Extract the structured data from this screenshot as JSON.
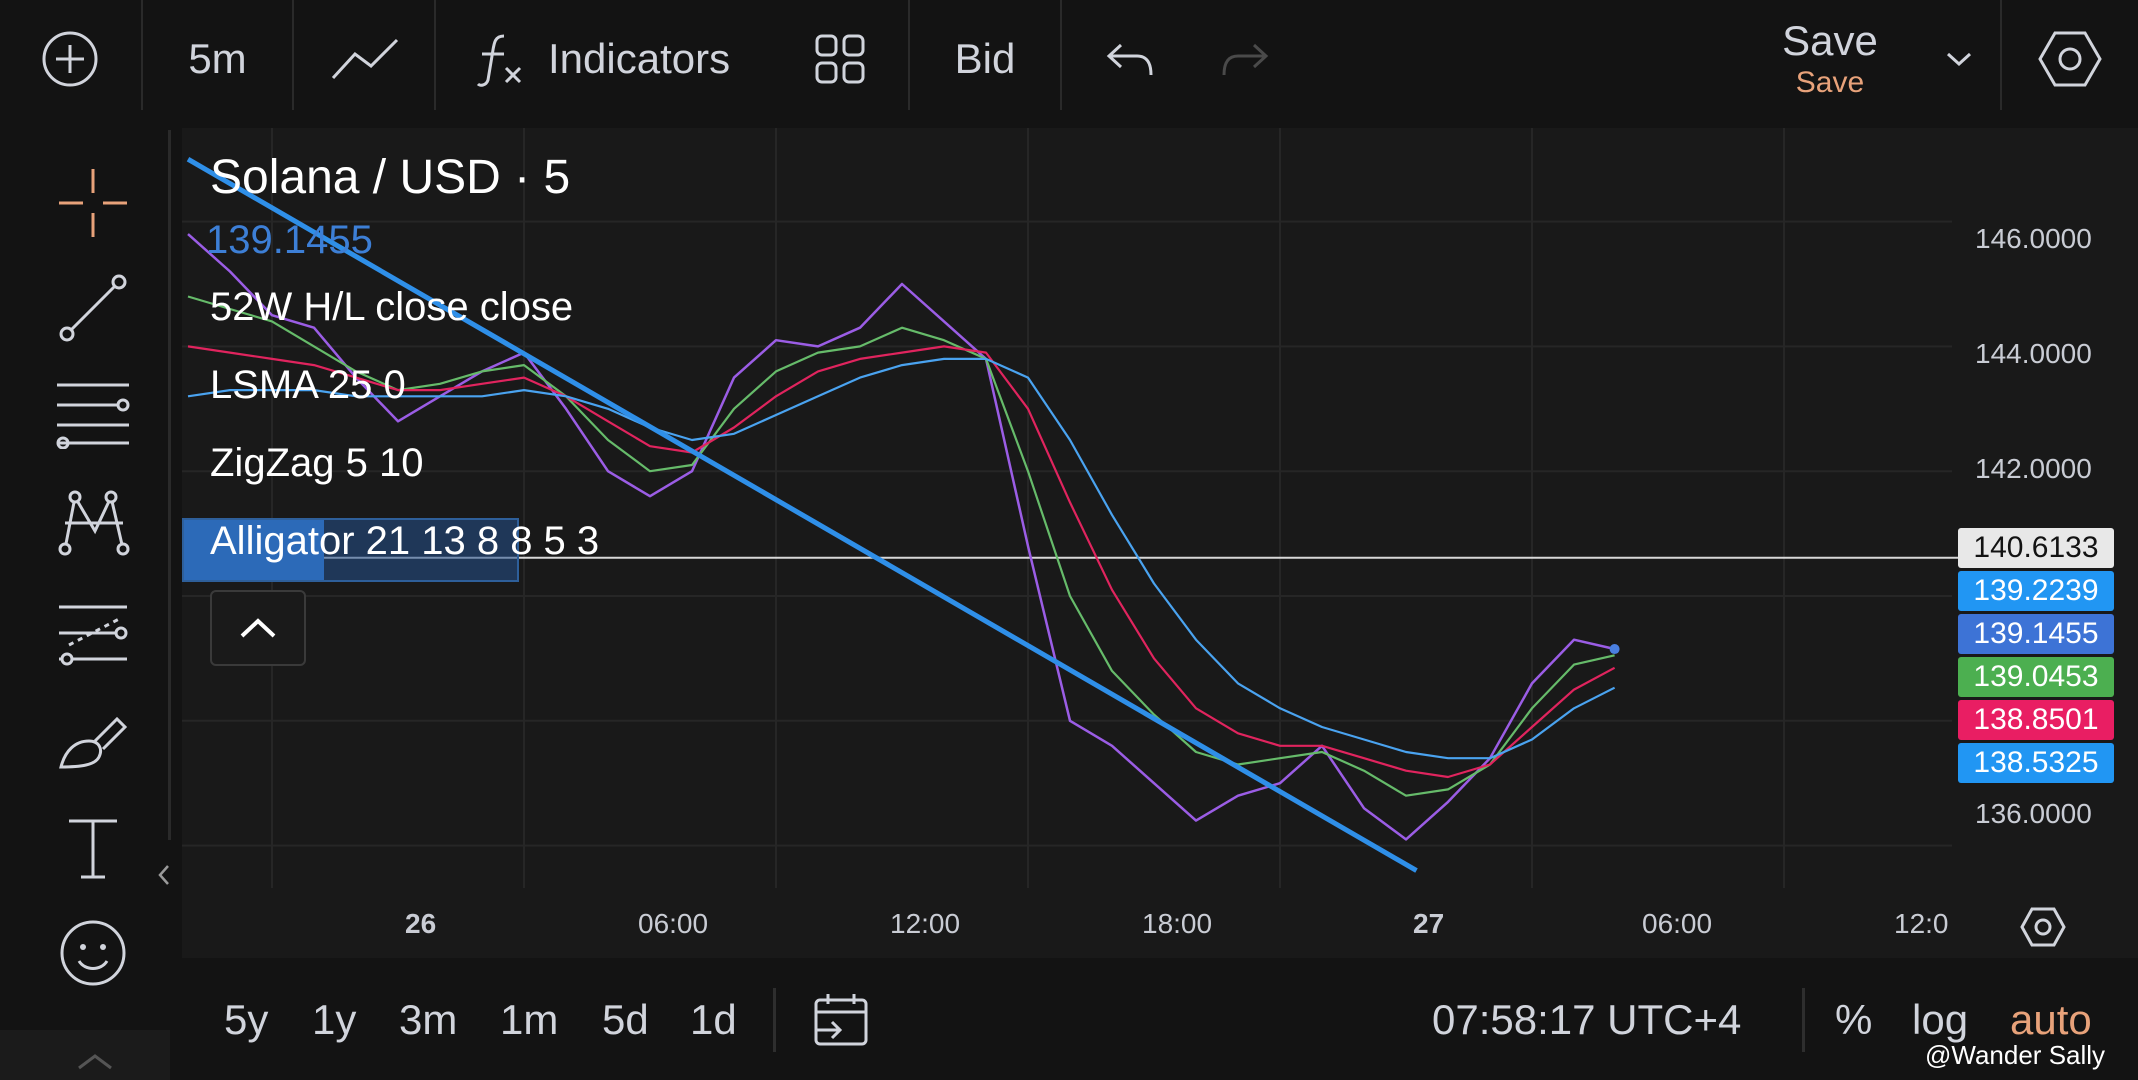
{
  "toolbar": {
    "interval": "5m",
    "indicators_label": "Indicators",
    "price_type": "Bid",
    "save_label": "Save",
    "save_sublabel": "Save"
  },
  "legend": {
    "title": "Solana / USD · 5",
    "last_price": "139.1455",
    "rows": [
      "52W H/L close close",
      "LSMA 25 0",
      "ZigZag 5 10",
      "Alligator 21 13 8 8 5 3"
    ]
  },
  "price_axis": {
    "ticks": [
      "146.0000",
      "144.0000",
      "142.0000",
      "136.0000"
    ],
    "tags": [
      {
        "value": "140.6133",
        "color": "#e8e8e8",
        "text_color": "#131313"
      },
      {
        "value": "139.2239",
        "color": "#2196f3",
        "text_color": "#ffffff"
      },
      {
        "value": "139.1455",
        "color": "#3d73d6",
        "text_color": "#ffffff"
      },
      {
        "value": "139.0453",
        "color": "#4caf50",
        "text_color": "#ffffff"
      },
      {
        "value": "138.8501",
        "color": "#e91e63",
        "text_color": "#ffffff"
      },
      {
        "value": "138.5325",
        "color": "#2196f3",
        "text_color": "#ffffff"
      }
    ]
  },
  "time_axis": {
    "ticks": [
      {
        "label": "26",
        "bold": true
      },
      {
        "label": "06:00",
        "bold": false
      },
      {
        "label": "12:00",
        "bold": false
      },
      {
        "label": "18:00",
        "bold": false
      },
      {
        "label": "27",
        "bold": true
      },
      {
        "label": "06:00",
        "bold": false
      },
      {
        "label": "12:0",
        "bold": false
      }
    ]
  },
  "bottom": {
    "ranges": [
      "5y",
      "1y",
      "3m",
      "1m",
      "5d",
      "1d"
    ],
    "clock": "07:58:17 UTC+4",
    "percent": "%",
    "log": "log",
    "auto": "auto"
  },
  "watermark": "@Wander Sally",
  "chart_data": {
    "type": "line",
    "x": [
      "25 22:00",
      "25 23:00",
      "26 00:00",
      "26 01:00",
      "26 02:00",
      "26 03:00",
      "26 04:00",
      "26 05:00",
      "26 06:00",
      "26 07:00",
      "26 08:00",
      "26 09:00",
      "26 10:00",
      "26 11:00",
      "26 12:00",
      "26 13:00",
      "26 14:00",
      "26 15:00",
      "26 16:00",
      "26 17:00",
      "26 18:00",
      "26 19:00",
      "26 20:00",
      "26 21:00",
      "26 22:00",
      "26 23:00",
      "27 00:00",
      "27 01:00",
      "27 02:00",
      "27 03:00",
      "27 04:00",
      "27 05:00",
      "27 06:00",
      "27 07:00",
      "27 07:58"
    ],
    "series": [
      {
        "values": [
          145.8,
          145.2,
          144.5,
          144.3,
          143.5,
          142.8,
          143.2,
          143.6,
          143.9,
          143.0,
          142.0,
          141.6,
          142.0,
          143.5,
          144.1,
          144.0,
          144.3,
          145.0,
          144.4,
          143.8,
          140.8,
          138.0,
          137.6,
          137.0,
          136.4,
          136.8,
          137.0,
          137.6,
          136.6,
          136.1,
          136.7,
          137.4,
          138.6,
          139.3,
          139.15
        ]
      },
      {
        "values": [
          144.8,
          144.6,
          144.4,
          144.0,
          143.6,
          143.3,
          143.4,
          143.6,
          143.7,
          143.2,
          142.5,
          142.0,
          142.1,
          143.0,
          143.6,
          143.9,
          144.0,
          144.3,
          144.1,
          143.8,
          142.0,
          140.0,
          138.8,
          138.1,
          137.5,
          137.3,
          137.4,
          137.5,
          137.2,
          136.8,
          136.9,
          137.3,
          138.2,
          138.9,
          139.05
        ]
      },
      {
        "values": [
          144.0,
          143.9,
          143.8,
          143.7,
          143.5,
          143.3,
          143.3,
          143.4,
          143.5,
          143.2,
          142.8,
          142.4,
          142.3,
          142.7,
          143.2,
          143.6,
          143.8,
          143.9,
          144.0,
          143.9,
          143.0,
          141.5,
          140.1,
          139.0,
          138.2,
          137.8,
          137.6,
          137.6,
          137.4,
          137.2,
          137.1,
          137.3,
          137.9,
          138.5,
          138.85
        ]
      },
      {
        "values": [
          143.2,
          143.3,
          143.3,
          143.3,
          143.2,
          143.2,
          143.2,
          143.2,
          143.3,
          143.2,
          143.0,
          142.7,
          142.5,
          142.6,
          142.9,
          143.2,
          143.5,
          143.7,
          143.8,
          143.8,
          143.5,
          142.5,
          141.3,
          140.2,
          139.3,
          138.6,
          138.2,
          137.9,
          137.7,
          137.5,
          137.4,
          137.4,
          137.7,
          138.2,
          138.53
        ]
      }
    ],
    "trendline": {
      "from": {
        "x": "25 22:00",
        "y": 147.0
      },
      "to": {
        "x": "27 03:15",
        "y": 135.6
      }
    },
    "horizontal_line": 140.6133,
    "ylim": [
      135,
      147.5
    ],
    "colors": {
      "price": "#9b5de5",
      "lips": "#66bb6a",
      "teeth": "#e0245e",
      "jaw": "#4aa3f0",
      "trend": "#2f8fe8"
    },
    "grid": true
  }
}
